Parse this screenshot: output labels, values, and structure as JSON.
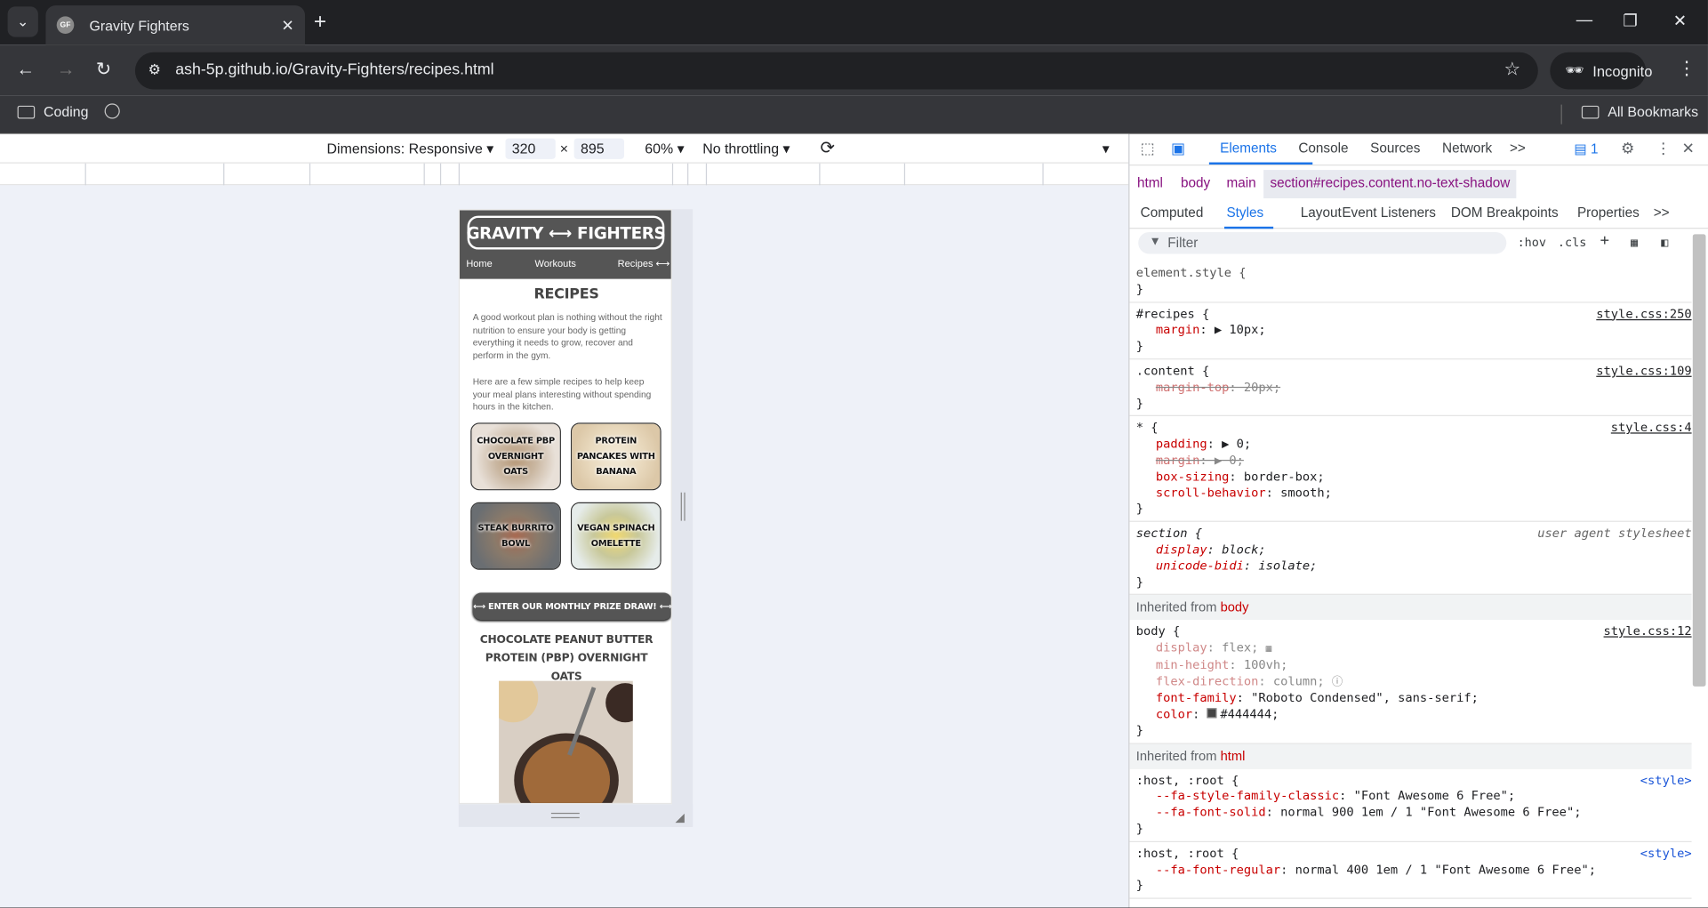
{
  "browser": {
    "tab_title": "Gravity Fighters",
    "favicon_text": "GF",
    "url": "ash-5p.github.io/Gravity-Fighters/recipes.html",
    "profile": "Incognito",
    "bookmarks": [
      {
        "label": "Coding"
      },
      {
        "label": ""
      }
    ],
    "all_bookmarks": "All Bookmarks"
  },
  "device_toolbar": {
    "dimensions_label": "Dimensions: Responsive",
    "width": "320",
    "times": "×",
    "height": "895",
    "zoom": "60%",
    "throttling": "No throttling"
  },
  "site": {
    "logo": "GRAVITY ⟷ FIGHTERS",
    "nav": {
      "home": "Home",
      "workouts": "Workouts",
      "recipes": "Recipes ⟷"
    },
    "page_title": "RECIPES",
    "intro_1": "A good workout plan is nothing without the right nutrition to ensure your body is getting everything it needs to grow, recover and perform in the gym.",
    "intro_2": "Here are a few simple recipes to help keep your meal plans interesting without spending hours in the kitchen.",
    "cards": [
      {
        "label": "CHOCOLATE PBP OVERNIGHT OATS"
      },
      {
        "label": "PROTEIN PANCAKES WITH BANANA"
      },
      {
        "label": "STEAK BURRITO BOWL"
      },
      {
        "label": "VEGAN SPINACH OMELETTE"
      }
    ],
    "prize_button": "⟷ ENTER OUR MONTHLY PRIZE DRAW! ⟷",
    "recipe_title": "CHOCOLATE PEANUT BUTTER PROTEIN (PBP) OVERNIGHT OATS"
  },
  "devtools": {
    "tabs": [
      "Elements",
      "Console",
      "Sources",
      "Network",
      ">>"
    ],
    "issues_count": "1",
    "breadcrumbs": [
      "html",
      "body",
      "main",
      "section#recipes.content.no-text-shadow"
    ],
    "subtabs": [
      "Computed",
      "Styles",
      "Layout",
      "Event Listeners",
      "DOM Breakpoints",
      "Properties",
      ">>"
    ],
    "filter_placeholder": "Filter",
    "hov": ":hov",
    "cls": ".cls",
    "rules": {
      "r0": {
        "selector": "element.style {",
        "close": "}"
      },
      "r1": {
        "selector": "#recipes {",
        "source": "style.css:250",
        "p1n": "margin",
        "p1v": ": ▶ 10px;",
        "close": "}"
      },
      "r2": {
        "selector": ".content {",
        "source": "style.css:109",
        "p1n": "margin-top",
        "p1v": ": 20px;",
        "close": "}"
      },
      "r3": {
        "selector": "* {",
        "source": "style.css:4",
        "p1n": "padding",
        "p1v": ": ▶ 0;",
        "p2n": "margin",
        "p2v": ": ▶ 0;",
        "p3n": "box-sizing",
        "p3v": ": border-box;",
        "p4n": "scroll-behavior",
        "p4v": ": smooth;",
        "close": "}"
      },
      "r4": {
        "selector": "section {",
        "source": "user agent stylesheet",
        "p1n": "display",
        "p1v": ": block;",
        "p2n": "unicode-bidi",
        "p2v": ": isolate;",
        "close": "}"
      },
      "inh_body": {
        "prefix": "Inherited from ",
        "name": "body"
      },
      "r5": {
        "selector": "body {",
        "source": "style.css:12",
        "p1n": "display",
        "p1v": ": flex;",
        "p2n": "min-height",
        "p2v": ": 100vh;",
        "p3n": "flex-direction",
        "p3v": ": column;",
        "p4n": "font-family",
        "p4v": ": \"Roboto Condensed\", sans-serif;",
        "p5n": "color",
        "p5v": "#444444;",
        "close": "}"
      },
      "inh_html": {
        "prefix": "Inherited from ",
        "name": "html"
      },
      "r6": {
        "selector": ":host, :root {",
        "source": "<style>",
        "p1n": "--fa-style-family-classic",
        "p1v": ": \"Font Awesome 6 Free\";",
        "p2n": "--fa-font-solid",
        "p2v": ": normal 900 1em / 1 \"Font Awesome 6 Free\";",
        "close": "}"
      },
      "r7": {
        "selector": ":host, :root {",
        "source": "<style>",
        "p1n": "--fa-font-regular",
        "p1v": ": normal 400 1em / 1 \"Font Awesome 6 Free\";",
        "close": "}"
      }
    }
  },
  "colors": {
    "accent": "#1a73e8",
    "site_header": "#555555",
    "text": "#444444"
  }
}
